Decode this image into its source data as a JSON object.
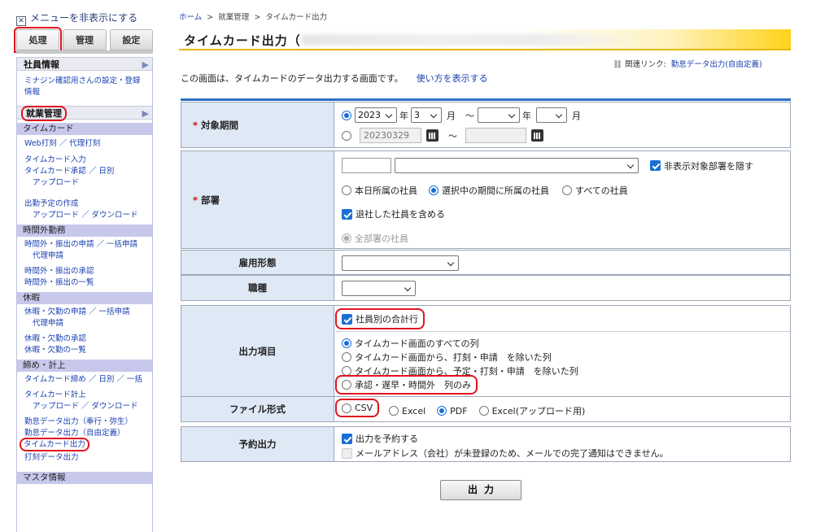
{
  "sidebar": {
    "toggle_label": "メニューを非表示にする",
    "tabs": [
      "処理",
      "管理",
      "設定"
    ],
    "employee_info": {
      "header": "社員情報",
      "links": [
        "ミナジン確認用さんの設定・登録",
        "情報"
      ]
    },
    "attendance": {
      "header": "就業管理",
      "timecard": {
        "header": "タイムカード",
        "links": [
          "Web打刻 ／ 代理打刻",
          "タイムカード入力",
          "タイムカード承認 ／ 日別",
          "アップロード",
          "出勤予定の作成",
          "アップロード ／ ダウンロード"
        ]
      },
      "overtime": {
        "header": "時間外勤務",
        "links": [
          "時間外・振出の申請 ／ 一括申請",
          "代理申請",
          "時間外・振出の承認",
          "時間外・振出の一覧"
        ]
      },
      "leave": {
        "header": "休暇",
        "links": [
          "休暇・欠勤の申請 ／ 一括申請",
          "代理申請",
          "休暇・欠勤の承認",
          "休暇・欠勤の一覧"
        ]
      },
      "closing": {
        "header": "締め・計上",
        "links": [
          "タイムカード締め ／ 日別 ／ 一括",
          "タイムカード計上",
          "アップロード ／ ダウンロード",
          "勤怠データ出力（奉行・弥生）",
          "勤怠データ出力（自由定義）",
          "タイムカード出力",
          "打刻データ出力"
        ]
      },
      "master": {
        "header": "マスタ情報"
      }
    }
  },
  "breadcrumb": {
    "home": "ホーム",
    "sep": ">",
    "level1": "就業管理",
    "level2": "タイムカード出力"
  },
  "page": {
    "title": "タイムカード出力（",
    "related_label": "関連リンク:",
    "related_link": "勤怠データ出力(自由定義)",
    "description": "この画面は、タイムカードのデータ出力する画面です。",
    "help_link": "使い方を表示する"
  },
  "form": {
    "period": {
      "label": "対象期間",
      "required_mark": "*",
      "year": "2023",
      "year_unit": "年",
      "month": "3",
      "month_unit": "月",
      "tilde": "〜",
      "end_year": "",
      "end_month": "",
      "date_from": "20230329",
      "date_to": ""
    },
    "department": {
      "label": "部署",
      "required_mark": "*",
      "code": "",
      "name": "",
      "hide_label": "非表示対象部署を隠す",
      "scope_options": [
        "本日所属の社員",
        "選択中の期間に所属の社員",
        "すべての社員"
      ],
      "include_retired": "退社した社員を含める",
      "all_depts": "全部署の社員"
    },
    "employment": {
      "label": "雇用形態",
      "value": ""
    },
    "job": {
      "label": "職種",
      "value": ""
    },
    "output": {
      "label": "出力項目",
      "total_by_employee": "社員別の合計行",
      "options": [
        "タイムカード画面のすべての列",
        "タイムカード画面から、打刻・申請　を除いた列",
        "タイムカード画面から、予定・打刻・申請　を除いた列",
        "承認・遅早・時間外　列のみ"
      ]
    },
    "file_format": {
      "label": "ファイル形式",
      "options": [
        "CSV",
        "Excel",
        "PDF",
        "Excel(アップロード用)"
      ]
    },
    "reserve": {
      "label": "予約出力",
      "reserve_label": "出力を予約する",
      "mail_notice": "メールアドレス（会社）が未登録のため、メールでの完了通知はできません。"
    }
  },
  "submit_label": "出力",
  "colors": {
    "accent_blue": "#2d6ec4",
    "title_yellow": "#ffd21a",
    "highlight_red": "#e0141e",
    "label_bg": "#dfe8f5"
  }
}
